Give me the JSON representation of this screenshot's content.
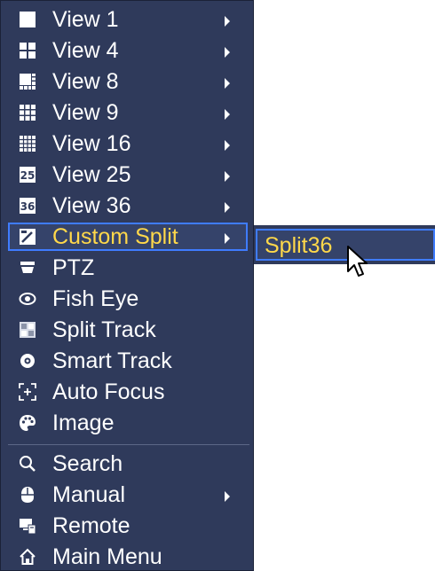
{
  "menu": {
    "items": [
      {
        "label": "View 1",
        "icon": "view-1-icon",
        "submenu": true
      },
      {
        "label": "View 4",
        "icon": "view-4-icon",
        "submenu": true
      },
      {
        "label": "View 8",
        "icon": "view-8-icon",
        "submenu": true
      },
      {
        "label": "View 9",
        "icon": "view-9-icon",
        "submenu": true
      },
      {
        "label": "View 16",
        "icon": "view-16-icon",
        "submenu": true
      },
      {
        "label": "View 25",
        "icon": "view-25-icon",
        "submenu": true,
        "icon_text": "25"
      },
      {
        "label": "View 36",
        "icon": "view-36-icon",
        "submenu": true,
        "icon_text": "36"
      },
      {
        "label": "Custom Split",
        "icon": "custom-split-icon",
        "submenu": true,
        "selected": true
      },
      {
        "label": "PTZ",
        "icon": "ptz-icon",
        "submenu": false
      },
      {
        "label": "Fish Eye",
        "icon": "fish-eye-icon",
        "submenu": false
      },
      {
        "label": "Split Track",
        "icon": "split-track-icon",
        "submenu": false
      },
      {
        "label": "Smart Track",
        "icon": "smart-track-icon",
        "submenu": false
      },
      {
        "label": "Auto Focus",
        "icon": "auto-focus-icon",
        "submenu": false
      },
      {
        "label": "Image",
        "icon": "image-icon",
        "submenu": false
      },
      {
        "label": "Search",
        "icon": "search-icon",
        "submenu": false
      },
      {
        "label": "Manual",
        "icon": "manual-icon",
        "submenu": true
      },
      {
        "label": "Remote",
        "icon": "remote-icon",
        "submenu": false
      },
      {
        "label": "Main Menu",
        "icon": "main-menu-icon",
        "submenu": false
      }
    ]
  },
  "submenu": {
    "items": [
      {
        "label": "Split36",
        "selected": true
      }
    ]
  },
  "colors": {
    "menu_background": "#2f3a5b",
    "selected_text": "#ffd84a",
    "selected_border": "#3f7cff",
    "text": "#ffffff"
  }
}
